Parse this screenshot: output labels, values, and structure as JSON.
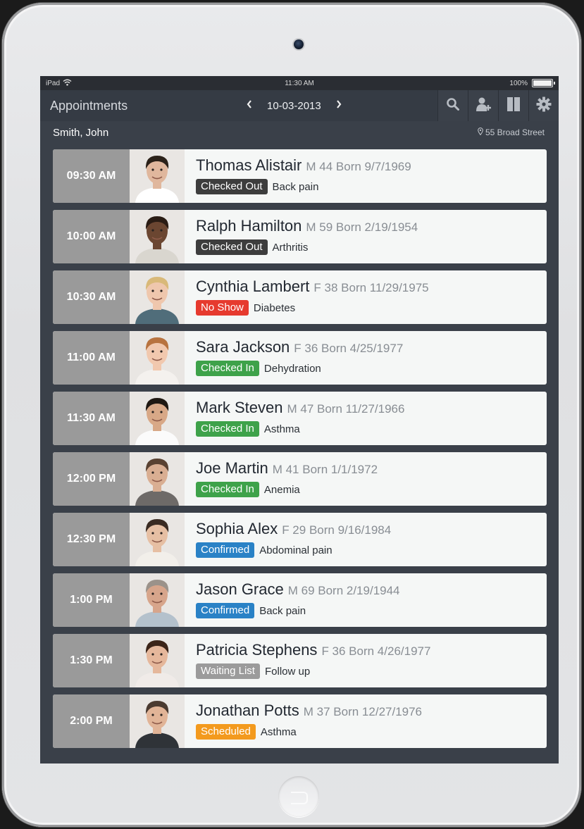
{
  "status_bar": {
    "device": "iPad",
    "time": "11:30 AM",
    "battery": "100%"
  },
  "nav": {
    "title": "Appointments",
    "date": "10-03-2013",
    "prev_icon": "chevron-left-icon",
    "next_icon": "chevron-right-icon",
    "icons": [
      "search-icon",
      "add-user-icon",
      "split-view-icon",
      "gear-icon"
    ]
  },
  "provider": {
    "name": "Smith, John",
    "location": "55 Broad Street"
  },
  "colors": {
    "checked_out": "#3d3d3d",
    "no_show": "#e63a2e",
    "checked_in": "#3ea24a",
    "confirmed": "#2a82c6",
    "waiting_list": "#9b9b9b",
    "scheduled": "#f39a1e"
  },
  "appointments": [
    {
      "time": "09:30 AM",
      "name": "Thomas Alistair",
      "meta": "M 44 Born 9/7/1969",
      "status": "Checked Out",
      "status_key": "checked_out",
      "reason": "Back pain",
      "photo": {
        "skin": "#e0b79d",
        "hair": "#2b2119",
        "shirt": "#ffffff"
      }
    },
    {
      "time": "10:00 AM",
      "name": "Ralph Hamilton",
      "meta": "M 59 Born 2/19/1954",
      "status": "Checked Out",
      "status_key": "checked_out",
      "reason": "Arthritis",
      "photo": {
        "skin": "#6b4631",
        "hair": "#2a1c14",
        "shirt": "#d9d6cf"
      }
    },
    {
      "time": "10:30 AM",
      "name": "Cynthia Lambert",
      "meta": "F 38 Born 11/29/1975",
      "status": "No Show",
      "status_key": "no_show",
      "reason": "Diabetes",
      "photo": {
        "skin": "#efc7ad",
        "hair": "#d9b979",
        "shirt": "#506d7a"
      }
    },
    {
      "time": "11:00 AM",
      "name": "Sara Jackson",
      "meta": "F 36 Born 4/25/1977",
      "status": "Checked In",
      "status_key": "checked_in",
      "reason": "Dehydration",
      "photo": {
        "skin": "#f1c8ae",
        "hair": "#b8733f",
        "shirt": "#f4f1ee"
      }
    },
    {
      "time": "11:30 AM",
      "name": "Mark Steven",
      "meta": "M 47 Born 11/27/1966",
      "status": "Checked In",
      "status_key": "checked_in",
      "reason": "Asthma",
      "photo": {
        "skin": "#d8a887",
        "hair": "#1f1812",
        "shirt": "#fbfbfb"
      }
    },
    {
      "time": "12:00 PM",
      "name": "Joe Martin",
      "meta": "M 41 Born 1/1/1972",
      "status": "Checked In",
      "status_key": "checked_in",
      "reason": "Anemia",
      "photo": {
        "skin": "#d9ae92",
        "hair": "#5a4232",
        "shirt": "#6e6a68"
      }
    },
    {
      "time": "12:30 PM",
      "name": "Sophia Alex",
      "meta": "F 29 Born 9/16/1984",
      "status": "Confirmed",
      "status_key": "confirmed",
      "reason": "Abdominal pain",
      "photo": {
        "skin": "#e6bfa3",
        "hair": "#3a2b22",
        "shirt": "#f2efea"
      }
    },
    {
      "time": "1:00 PM",
      "name": "Jason Grace",
      "meta": "M 69 Born 2/19/1944",
      "status": "Confirmed",
      "status_key": "confirmed",
      "reason": "Back pain",
      "photo": {
        "skin": "#d7a58b",
        "hair": "#9b928a",
        "shirt": "#b4c1cc"
      }
    },
    {
      "time": "1:30 PM",
      "name": "Patricia Stephens",
      "meta": "F 36 Born 4/26/1977",
      "status": "Waiting List",
      "status_key": "waiting_list",
      "reason": "Follow up",
      "photo": {
        "skin": "#e5b79b",
        "hair": "#3b2418",
        "shirt": "#f0ebe8"
      }
    },
    {
      "time": "2:00 PM",
      "name": "Jonathan Potts",
      "meta": "M 37 Born 12/27/1976",
      "status": "Scheduled",
      "status_key": "scheduled",
      "reason": "Asthma",
      "photo": {
        "skin": "#e1b497",
        "hair": "#4a3a30",
        "shirt": "#2f3338"
      }
    }
  ]
}
